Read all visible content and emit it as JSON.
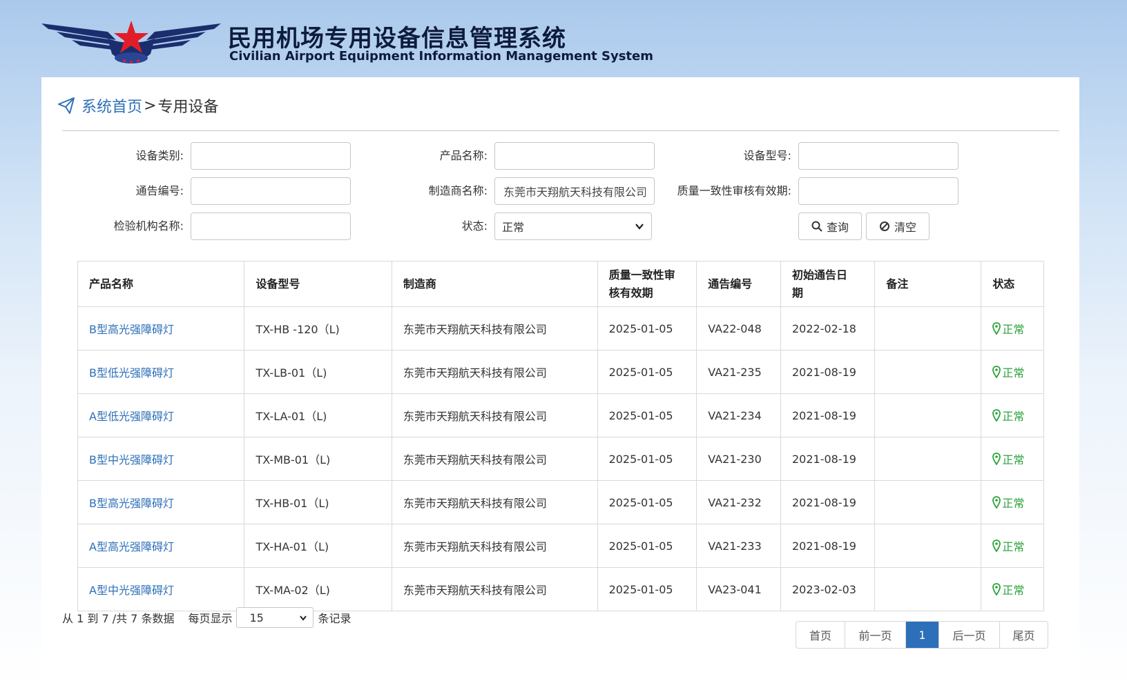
{
  "header": {
    "title_cn": "民用机场专用设备信息管理系统",
    "title_en": "Civilian Airport Equipment Information Management System"
  },
  "breadcrumb": {
    "home": "系统首页",
    "separator": ">",
    "current": "专用设备"
  },
  "filters": {
    "equipment_category": {
      "label": "设备类别:",
      "value": ""
    },
    "product_name": {
      "label": "产品名称:",
      "value": ""
    },
    "equipment_model": {
      "label": "设备型号:",
      "value": ""
    },
    "notice_number": {
      "label": "通告编号:",
      "value": ""
    },
    "manufacturer_name": {
      "label": "制造商名称:",
      "value": "东莞市天翔航天科技有限公司"
    },
    "quality_validity": {
      "label": "质量一致性审核有效期:",
      "value": ""
    },
    "inspection_org": {
      "label": "检验机构名称:",
      "value": ""
    },
    "status": {
      "label": "状态:",
      "value": "正常"
    },
    "query_button": "查询",
    "clear_button": "清空"
  },
  "table": {
    "headers": [
      "产品名称",
      "设备型号",
      "制造商",
      "质量一致性审核有效期",
      "通告编号",
      "初始通告日期",
      "备注",
      "状态"
    ],
    "header_lines": {
      "validity": [
        "质量一致性审",
        "核有效期"
      ],
      "initial_date": [
        "初始通告日",
        "期"
      ]
    },
    "rows": [
      {
        "product": "B型高光强障碍灯",
        "model": "TX-HB -120（L)",
        "manufacturer": "东莞市天翔航天科技有限公司",
        "validity": "2025-01-05",
        "notice": "VA22-048",
        "initial_date": "2022-02-18",
        "remark": "",
        "status": "正常"
      },
      {
        "product": "B型低光强障碍灯",
        "model": "TX-LB-01（L)",
        "manufacturer": "东莞市天翔航天科技有限公司",
        "validity": "2025-01-05",
        "notice": "VA21-235",
        "initial_date": "2021-08-19",
        "remark": "",
        "status": "正常"
      },
      {
        "product": "A型低光强障碍灯",
        "model": "TX-LA-01（L)",
        "manufacturer": "东莞市天翔航天科技有限公司",
        "validity": "2025-01-05",
        "notice": "VA21-234",
        "initial_date": "2021-08-19",
        "remark": "",
        "status": "正常"
      },
      {
        "product": "B型中光强障碍灯",
        "model": "TX-MB-01（L)",
        "manufacturer": "东莞市天翔航天科技有限公司",
        "validity": "2025-01-05",
        "notice": "VA21-230",
        "initial_date": "2021-08-19",
        "remark": "",
        "status": "正常"
      },
      {
        "product": "B型高光强障碍灯",
        "model": "TX-HB-01（L)",
        "manufacturer": "东莞市天翔航天科技有限公司",
        "validity": "2025-01-05",
        "notice": "VA21-232",
        "initial_date": "2021-08-19",
        "remark": "",
        "status": "正常"
      },
      {
        "product": "A型高光强障碍灯",
        "model": "TX-HA-01（L)",
        "manufacturer": "东莞市天翔航天科技有限公司",
        "validity": "2025-01-05",
        "notice": "VA21-233",
        "initial_date": "2021-08-19",
        "remark": "",
        "status": "正常"
      },
      {
        "product": "A型中光强障碍灯",
        "model": "TX-MA-02（L)",
        "manufacturer": "东莞市天翔航天科技有限公司",
        "validity": "2025-01-05",
        "notice": "VA23-041",
        "initial_date": "2023-02-03",
        "remark": "",
        "status": "正常"
      }
    ]
  },
  "pagination": {
    "info": "从 1 到 7 /共 7 条数据",
    "per_page_label": "每页显示",
    "per_page_value": "15",
    "records_label": "条记录",
    "first": "首页",
    "prev": "前一页",
    "current_page": "1",
    "next": "后一页",
    "last": "尾页"
  },
  "colors": {
    "brand_navy": "#1a2e6e",
    "star_red": "#e21d2a",
    "link_blue": "#2d6fb8",
    "status_green": "#2aa23a"
  },
  "icons": [
    "airport-wings-logo",
    "paper-plane-icon",
    "search-icon",
    "ban-icon",
    "chevron-down-icon",
    "map-pin-icon"
  ]
}
